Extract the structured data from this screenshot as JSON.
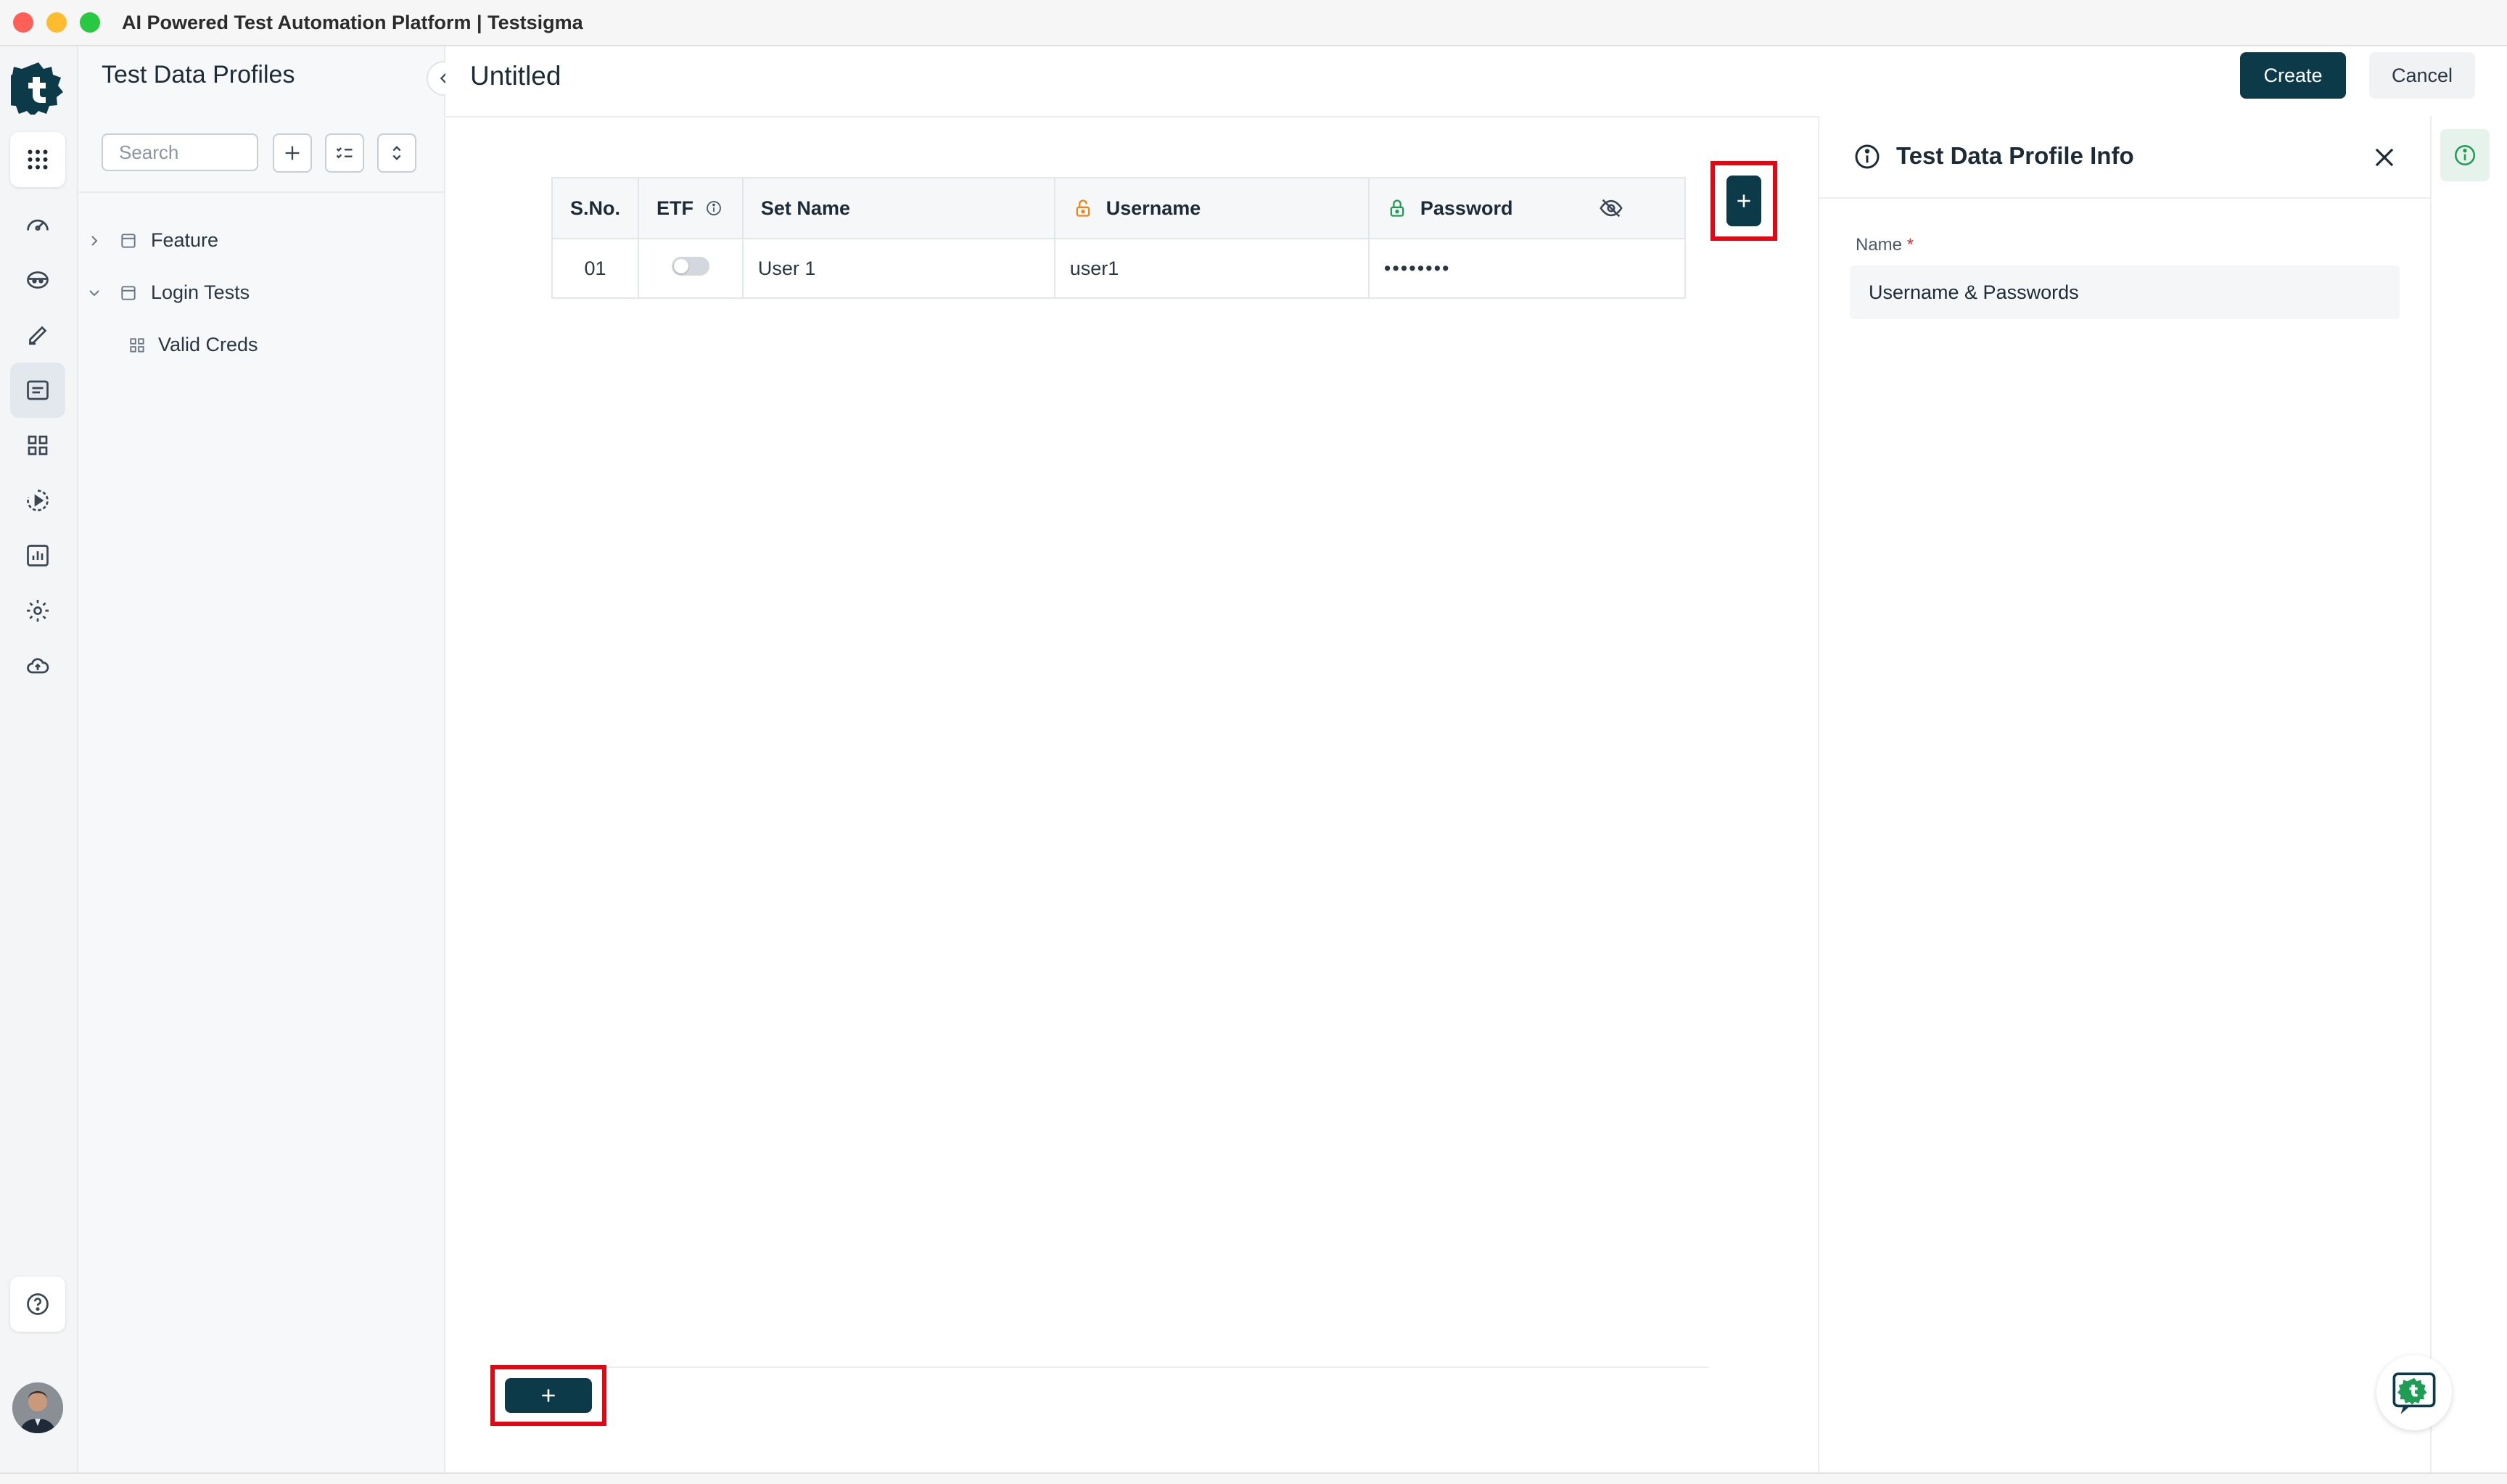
{
  "window": {
    "title": "AI Powered Test Automation Platform | Testsigma"
  },
  "sidebar": {
    "title": "Test Data Profiles",
    "search_placeholder": "Search",
    "tree": [
      {
        "label": "Feature",
        "expanded": false
      },
      {
        "label": "Login Tests",
        "expanded": true
      },
      {
        "label": "Valid Creds",
        "child": true
      }
    ]
  },
  "header": {
    "title": "Untitled",
    "create_label": "Create",
    "cancel_label": "Cancel"
  },
  "table": {
    "columns": [
      "S.No.",
      "ETF",
      "Set Name",
      "Username",
      "Password"
    ],
    "rows": [
      {
        "sno": "01",
        "etf_enabled": false,
        "set_name": "User 1",
        "username": "user1",
        "password": "••••••••"
      }
    ]
  },
  "panel": {
    "title": "Test Data Profile Info",
    "name_label": "Name",
    "required_mark": "*",
    "name_value": "Username & Passwords"
  },
  "colors": {
    "primary": "#0d3a49",
    "highlight": "#e30613",
    "lock_orange": "#e8891a",
    "lock_green": "#1f9d55",
    "brand": "#0d3a49"
  }
}
